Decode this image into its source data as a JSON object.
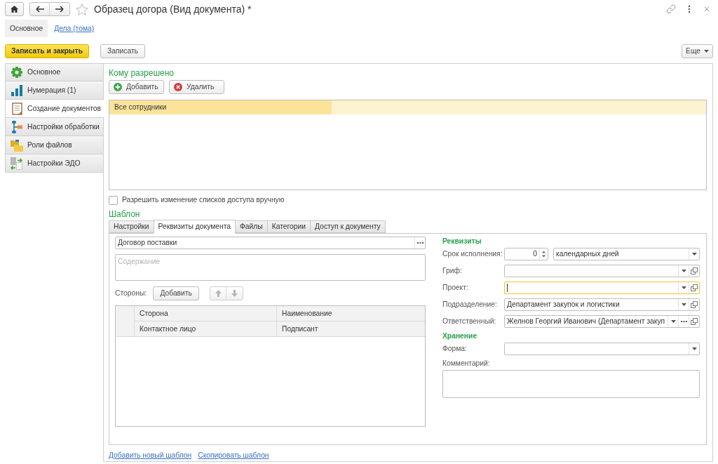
{
  "window": {
    "title": "Образец догора (Вид документа) *"
  },
  "section_tabs": [
    {
      "label": "Основное",
      "selected": true
    },
    {
      "label": "Дела (тома)",
      "selected": false
    }
  ],
  "command_bar": {
    "buttons": [
      {
        "label": "Записать и закрыть",
        "kind": "primary"
      },
      {
        "label": "Записать",
        "kind": "default"
      }
    ],
    "more": "Еще"
  },
  "sidebar": {
    "items": [
      {
        "label": "Основное",
        "selected": false
      },
      {
        "label": "Нумерация (1)",
        "selected": false
      },
      {
        "label": "Создание документов",
        "selected": true
      },
      {
        "label": "Настройки обработки",
        "selected": false
      },
      {
        "label": "Роли файлов",
        "selected": false
      },
      {
        "label": "Настройки ЭДО",
        "selected": false
      }
    ]
  },
  "access": {
    "title": "Кому разрешено",
    "buttons": [
      {
        "label": "Добавить",
        "kind": "add"
      },
      {
        "label": "Удалить",
        "kind": "delete"
      }
    ],
    "rows": [
      {
        "text": "Все сотрудники",
        "selected": true
      }
    ],
    "manual_change": {
      "label": "Разрешить изменение списков доступа вручную",
      "checked": false
    }
  },
  "template": {
    "title": "Шаблон",
    "tabs": [
      {
        "label": "Настройки",
        "selected": false
      },
      {
        "label": "Реквизиты документа",
        "selected": true
      },
      {
        "label": "Файлы",
        "selected": false
      },
      {
        "label": "Категории",
        "selected": false
      },
      {
        "label": "Доступ к документу",
        "selected": false
      }
    ],
    "document_kind": "Договор поставки",
    "content": {
      "placeholder": "Содержание"
    },
    "parties": {
      "label": "Стороны:",
      "add_button": "Добавить",
      "move_disabled": true,
      "columns": [
        {
          "top": "Сторона",
          "bottom": "Контактное лицо"
        },
        {
          "top": "Наименование",
          "bottom": "Подписант"
        }
      ]
    },
    "sections": [
      {
        "title": "Реквизиты",
        "fields": [
          {
            "label": "Срок исполнения:",
            "kind": "duration",
            "value": "0",
            "unit": "календарных дней",
            "focused": false
          },
          {
            "label": "Гриф:",
            "kind": "select_open",
            "focused": false
          },
          {
            "label": "Проект:",
            "kind": "select_open",
            "focused": true
          },
          {
            "label": "Подразделение:",
            "kind": "select_open",
            "value": "Департамент закупок и логистики",
            "focused": false
          },
          {
            "label": "Ответственный:",
            "kind": "select_choose_open",
            "value": "Желнов Георгий Иванович (Департамент закуп",
            "focused": false
          }
        ]
      },
      {
        "title": "Хранение",
        "fields": [
          {
            "label": "Форма:",
            "kind": "select",
            "focused": false
          },
          {
            "label": "Комментарий:",
            "kind": "textarea",
            "focused": false
          }
        ]
      }
    ]
  },
  "links": [
    "Добавить новый шаблон",
    "Скопировать шаблон"
  ]
}
